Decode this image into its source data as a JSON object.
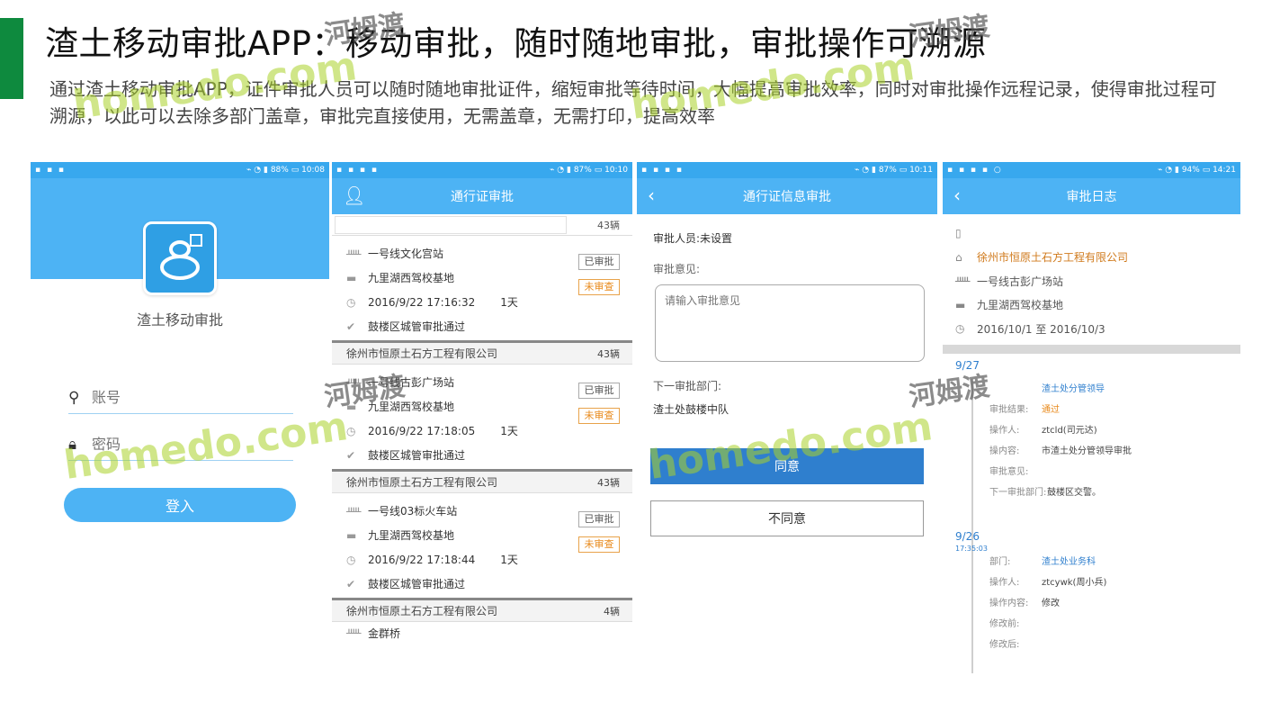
{
  "slide": {
    "title": "渣土移动审批APP：移动审批，随时随地审批，审批操作可溯源",
    "description": "通过渣土移动审批APP，证件审批人员可以随时随地审批证件，缩短审批等待时间，大幅提高审批效率，同时对审批操作远程记录，使得审批过程可溯源，以此可以去除多部门盖章，审批完直接使用，无需盖章，无需打印，提高效率",
    "accent_color": "#0e8a3e"
  },
  "watermark": {
    "text": "homedo.com",
    "text_cn": "河姆渡"
  },
  "phones": {
    "login": {
      "status_time": "10:08",
      "status_battery": "88%",
      "app_name": "渣土移动审批",
      "username_placeholder": "账号",
      "password_placeholder": "密码",
      "login_label": "登入"
    },
    "list": {
      "status_time": "10:10",
      "status_battery": "87%",
      "title": "通行证审批",
      "header_count": "43辆",
      "cards": [
        {
          "line": "一号线文化宫站",
          "base": "九里湖西驾校基地",
          "time": "2016/9/22 17:16:32",
          "days": "1天",
          "result": "鼓楼区城管审批通过",
          "approved": "已审批",
          "unreviewed": "未审查",
          "company": "徐州市恒原土石方工程有限公司",
          "count": "43辆"
        },
        {
          "line": "一号线古彭广场站",
          "base": "九里湖西驾校基地",
          "time": "2016/9/22 17:18:05",
          "days": "1天",
          "result": "鼓楼区城管审批通过",
          "approved": "已审批",
          "unreviewed": "未审查",
          "company": "徐州市恒原土石方工程有限公司",
          "count": "43辆"
        },
        {
          "line": "一号线03标火车站",
          "base": "九里湖西驾校基地",
          "time": "2016/9/22 17:18:44",
          "days": "1天",
          "result": "鼓楼区城管审批通过",
          "approved": "已审批",
          "unreviewed": "未审查",
          "company": "徐州市恒原土石方工程有限公司",
          "count": "4辆"
        }
      ],
      "next_item": "金群桥"
    },
    "detail": {
      "status_time": "10:11",
      "status_battery": "87%",
      "title": "通行证信息审批",
      "reviewer": "审批人员:未设置",
      "opinion_label": "审批意见:",
      "opinion_placeholder": "请输入审批意见",
      "next_dept_label": "下一审批部门:",
      "next_dept_value": "渣土处鼓楼中队",
      "agree_label": "同意",
      "disagree_label": "不同意"
    },
    "log": {
      "status_time": "14:21",
      "status_battery": "94%",
      "title": "审批日志",
      "company": "徐州市恒原土石方工程有限公司",
      "line": "一号线古彭广场站",
      "base": "九里湖西驾校基地",
      "period": "2016/10/1 至 2016/10/3",
      "entries": [
        {
          "date": "9/27",
          "time": "",
          "rows": [
            {
              "k": "",
              "v": "渣土处分管领导",
              "style": "blue"
            },
            {
              "k": "审批结果:",
              "v": "通过",
              "style": "orange"
            },
            {
              "k": "操作人:",
              "v": "ztcld(司元达)",
              "style": ""
            },
            {
              "k": "操内容:",
              "v": "市渣土处分管领导审批",
              "style": ""
            },
            {
              "k": "审批意见:",
              "v": "",
              "style": ""
            },
            {
              "k": "下一审批部门:",
              "v": "鼓楼区交警。",
              "style": ""
            }
          ]
        },
        {
          "date": "9/26",
          "time": "17:35:03",
          "rows": [
            {
              "k": "部门:",
              "v": "渣土处业务科",
              "style": "blue"
            },
            {
              "k": "操作人:",
              "v": "ztcywk(周小兵)",
              "style": ""
            },
            {
              "k": "操作内容:",
              "v": "修改",
              "style": ""
            },
            {
              "k": "修改前:",
              "v": "",
              "style": ""
            },
            {
              "k": "修改后:",
              "v": "",
              "style": ""
            }
          ]
        }
      ]
    }
  }
}
